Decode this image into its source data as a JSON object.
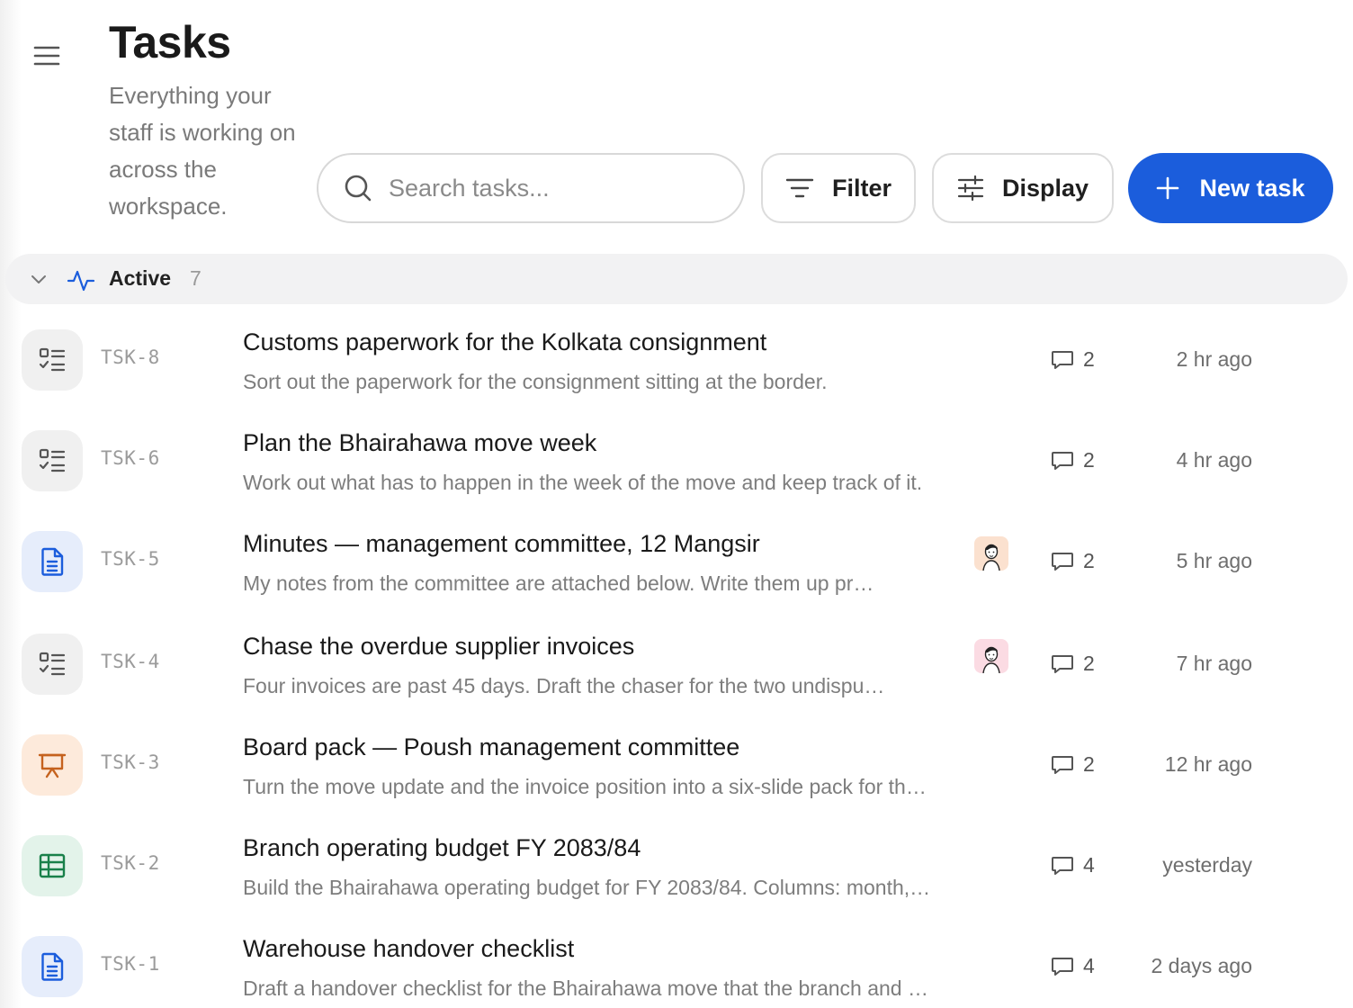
{
  "header": {
    "menu_icon": "hamburger-menu-icon",
    "title": "Tasks",
    "subtitle": "Everything your staff is working on across the workspace."
  },
  "toolbar": {
    "search_placeholder": "Search tasks...",
    "filter_label": "Filter",
    "display_label": "Display",
    "new_task_label": "New task",
    "accent_color": "#1b5ddc"
  },
  "group": {
    "label": "Active",
    "count": "7",
    "icon": "activity-pulse-icon"
  },
  "tasks": [
    {
      "id": "TSK-8",
      "type_icon": "checklist-icon",
      "title": "Customs paperwork for the Kolkata consignment",
      "description": "Sort out the paperwork for the consignment sitting at the border.",
      "comments": "2",
      "time": "2 hr ago",
      "assignee": null
    },
    {
      "id": "TSK-6",
      "type_icon": "checklist-icon",
      "title": "Plan the Bhairahawa move week",
      "description": "Work out what has to happen in the week of the move and keep track of it.",
      "comments": "2",
      "time": "4 hr ago",
      "assignee": null
    },
    {
      "id": "TSK-5",
      "type_icon": "document-icon",
      "title": "Minutes — management committee, 12 Mangsir",
      "description": "My notes from the committee are attached below. Write them up pr…",
      "comments": "2",
      "time": "5 hr ago",
      "assignee": "avatar-peach"
    },
    {
      "id": "TSK-4",
      "type_icon": "checklist-icon",
      "title": "Chase the overdue supplier invoices",
      "description": "Four invoices are past 45 days. Draft the chaser for the two undispu…",
      "comments": "2",
      "time": "7 hr ago",
      "assignee": "avatar-pink"
    },
    {
      "id": "TSK-3",
      "type_icon": "presentation-icon",
      "title": "Board pack — Poush management committee",
      "description": "Turn the move update and the invoice position into a six-slide pack for th…",
      "comments": "2",
      "time": "12 hr ago",
      "assignee": null
    },
    {
      "id": "TSK-2",
      "type_icon": "spreadsheet-icon",
      "title": "Branch operating budget FY 2083/84",
      "description": "Build the Bhairahawa operating budget for FY 2083/84. Columns: month,…",
      "comments": "4",
      "time": "yesterday",
      "assignee": null
    },
    {
      "id": "TSK-1",
      "type_icon": "document-icon",
      "title": "Warehouse handover checklist",
      "description": "Draft a handover checklist for the Bhairahawa move that the branch and …",
      "comments": "4",
      "time": "2 days ago",
      "assignee": null
    }
  ]
}
